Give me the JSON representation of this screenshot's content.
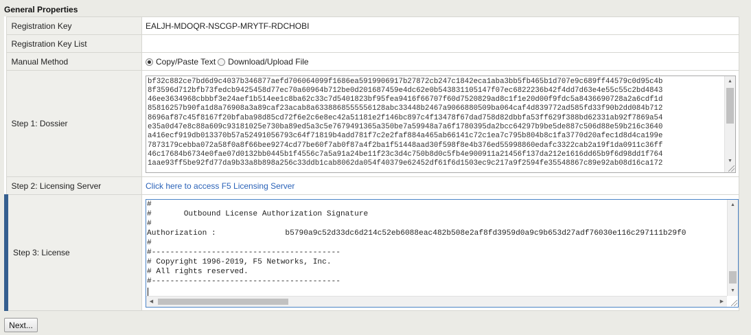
{
  "section_title": "General Properties",
  "rows": {
    "registration_key": {
      "label": "Registration Key",
      "value": "EALJH-MDOQR-NSCGP-MRYTF-RDCHOBI"
    },
    "registration_key_list": {
      "label": "Registration Key List",
      "value": ""
    },
    "manual_method": {
      "label": "Manual Method",
      "options": [
        "Copy/Paste Text",
        "Download/Upload File"
      ],
      "selected": "Copy/Paste Text"
    },
    "step1": {
      "label": "Step 1: Dossier",
      "dossier_text": "bf32c882ce7bd6d9c4037b346877aefd706064099f1686ea5919906917b27872cb247c1842eca1aba3bb5fb465b1d707e9c689ff44579c0d95c4b\n8f3596d712bfb73fedcb9425458d77ec70a60964b712be0d201687459e4dc62e0b543831105147f07ec6822236b42f4dd7d63e4e55c55c2bd4843\n46ee3634968cbbbf3e24aef1b514ee1c8ba62c33c7d5401823bf95fea9416f66707f60d7520829ad8c1f1e20d00f9fdc5a8436690728a2a6cdf1d\n85816257b90fa1d8a76908a3a89caf23acab8a6338868555556128abc33448b2467a9066880509ba064caf4d839772ad585fd33f90b2dd084b712\n8696af87c45f8167f20bfaba98d85cd72f6e2c6e8ec42a51181e2f146bc897c4f13478f67dad758d82dbbfa53ff629f388bd62331ab92f7869a54\ne35a0d47e8c88a609c93181025e730ba89ed5a3c5e7679491365a350be7a59948a7a6f1780395da2bcc64297b9be5de887c506d88e59b216c3640\na416ecf919db013370b57a52491056793c64f71819b4add781f7c2e2faf884a465ab66141c72c1ea7c795b804b8c1fa3770d20afec1d8d4ca199e\n7873179cebba072a58f0a8f66bee9274cd77be60f7ab0f87a4f2ba1f51448aad30f598f8e4b376ed55998860edafc3322cab2a19f1da0911c36ff\n46c17684b6734e0fae07d0132bb0445b1f4556c7a5a91a24be11f23c3d4c750b8d0c5fb4e900911a21456f137da212e1616dd65b9f6d98dd1f764\n1aae93ff5be92fd77da9b33a8b898a256c33ddb1cab8062da054f40379e62452df61f6d1503ec9c217a9f2594fe35548867c89e92ab08d16ca172"
    },
    "step2": {
      "label": "Step 2: Licensing Server",
      "link_text": "Click here to access F5 Licensing Server"
    },
    "step3": {
      "label": "Step 3: License",
      "license_lines": [
        "#",
        "#       Outbound License Authorization Signature",
        "#",
        "Authorization :               b5790a9c52d33dc6d214c52eb6088eac482b508e2af8fd3959d0a9c9b653d27adf76030e116c297111b29f0",
        "#",
        "#-----------------------------------------",
        "# Copyright 1996-2019, F5 Networks, Inc.",
        "# All rights reserved.",
        "#-----------------------------------------"
      ]
    }
  },
  "next_button": "Next...",
  "colors": {
    "accent": "#355f8f",
    "link": "#2a62b8",
    "focus_border": "#4a83c6"
  },
  "icons": {
    "scroll_up": "triangle-up-icon",
    "scroll_down": "triangle-down-icon",
    "scroll_left": "triangle-left-icon",
    "scroll_right": "triangle-right-icon",
    "resize": "resize-grip-icon"
  }
}
